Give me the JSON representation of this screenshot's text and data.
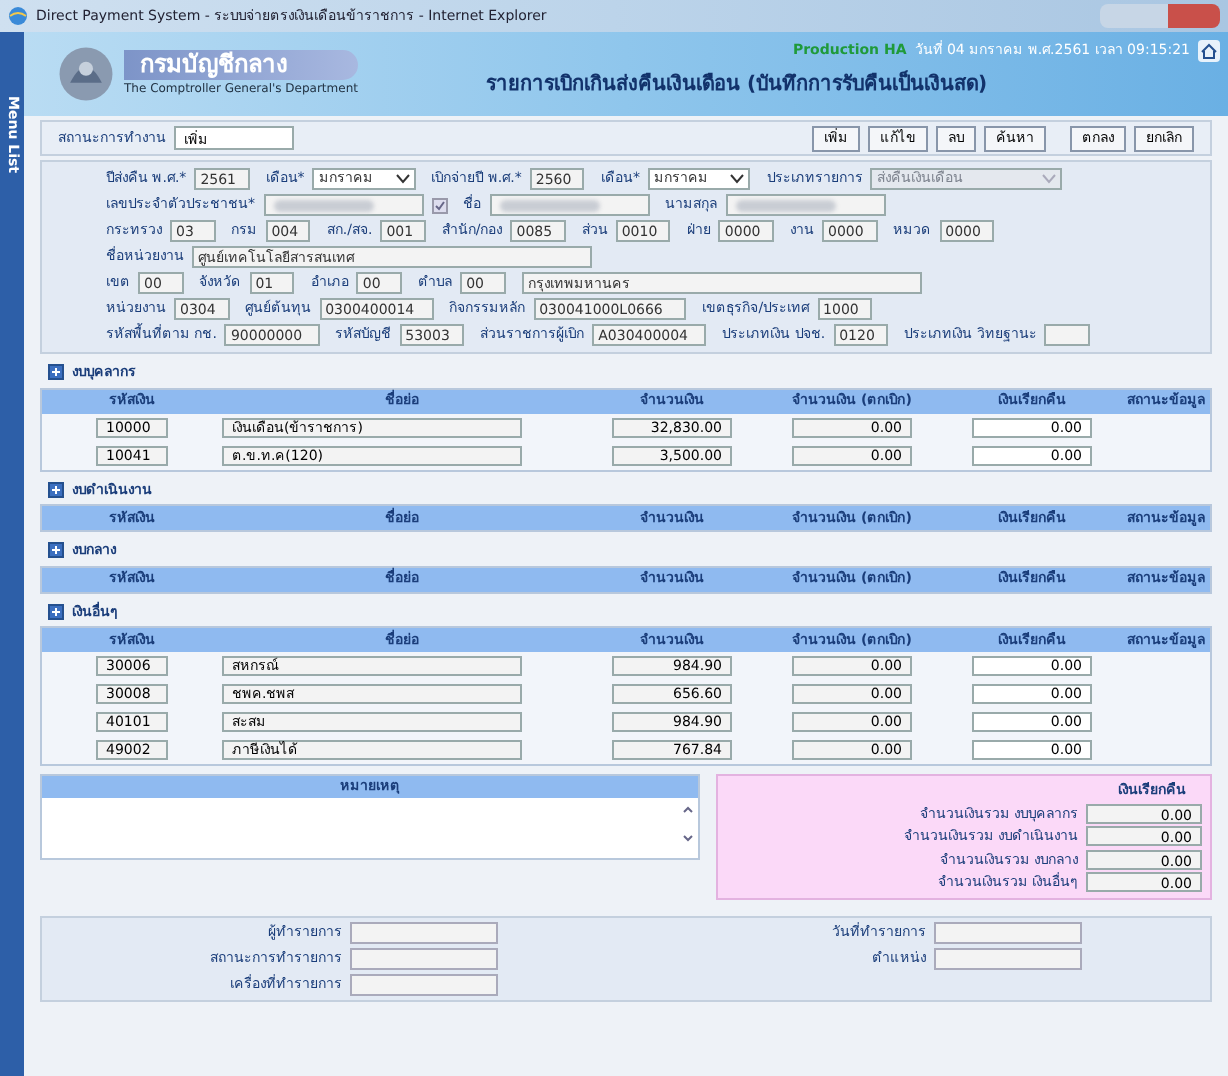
{
  "window": {
    "title": "Direct Payment System - ระบบจ่ายตรงเงินเดือนข้าราชการ - Internet Explorer"
  },
  "side_tab": {
    "label": "Menu List"
  },
  "header": {
    "org_name": "กรมบัญชีกลาง",
    "org_name_en": "The Comptroller General's Department",
    "environment": "Production HA",
    "datetime": "วันที่ 04 มกราคม พ.ศ.2561 เวลา 09:15:21",
    "page_title": "รายการเบิกเกินส่งคืนเงินเดือน (บันทึกการรับคืนเป็นเงินสด)"
  },
  "toolbar": {
    "status_label": "สถานะการทำงาน",
    "status_value": "เพิ่ม",
    "buttons": [
      "เพิ่ม",
      "แก้ไข",
      "ลบ",
      "ค้นหา",
      "ตกลง",
      "ยกเลิก"
    ]
  },
  "form": {
    "period": [
      {
        "label": "ปีส่งคืน พ.ศ.*",
        "value": "2561",
        "kind": "text"
      },
      {
        "label": "เดือน*",
        "value": "มกราคม",
        "kind": "select"
      },
      {
        "label": "เบิกจ่ายปี พ.ศ.*",
        "value": "2560",
        "kind": "text"
      },
      {
        "label": "เดือน*",
        "value": "มกราคม",
        "kind": "select"
      },
      {
        "label": "ประเภทรายการ",
        "value": "ส่งคืนเงินเดือน",
        "kind": "disabled_select"
      }
    ],
    "person": [
      {
        "label": "เลขประจำตัวประชาชน*",
        "kind": "redacted_check"
      },
      {
        "label": "ชื่อ",
        "kind": "redacted"
      },
      {
        "label": "นามสกุล",
        "kind": "redacted"
      }
    ],
    "org_codes": [
      {
        "label": "กระทรวง",
        "value": "03",
        "kind": "text"
      },
      {
        "label": "กรม",
        "value": "004",
        "kind": "text"
      },
      {
        "label": "สก./สจ.",
        "value": "001",
        "kind": "text"
      },
      {
        "label": "สำนัก/กอง",
        "value": "0085",
        "kind": "text"
      },
      {
        "label": "ส่วน",
        "value": "0010",
        "kind": "text"
      },
      {
        "label": "ฝ่าย",
        "value": "0000",
        "kind": "text"
      },
      {
        "label": "งาน",
        "value": "0000",
        "kind": "text"
      },
      {
        "label": "หมวด",
        "value": "0000",
        "kind": "text"
      }
    ],
    "unit": [
      {
        "label": "ชื่อหน่วยงาน",
        "value": "ศูนย์เทคโนโลยีสารสนเทศ",
        "kind": "wide"
      }
    ],
    "location": [
      {
        "label": "เขต",
        "value": "00",
        "kind": "text"
      },
      {
        "label": "จังหวัด",
        "value": "01",
        "kind": "text"
      },
      {
        "label": "อำเภอ",
        "value": "00",
        "kind": "text"
      },
      {
        "label": "ตำบล",
        "value": "00",
        "kind": "text"
      },
      {
        "value": "กรุงเทพมหานคร",
        "kind": "wide"
      }
    ],
    "accounts": [
      {
        "label": "หน่วยงาน",
        "value": "0304",
        "kind": "text"
      },
      {
        "label": "ศูนย์ต้นทุน",
        "value": "0300400014",
        "kind": "text"
      },
      {
        "label": "กิจกรรมหลัก",
        "value": "030041000L0666",
        "kind": "text"
      },
      {
        "label": "เขตธุรกิจ/ประเทศ",
        "value": "1000",
        "kind": "text"
      }
    ],
    "budget_codes": [
      {
        "label": "รหัสพื้นที่ตาม กช.",
        "value": "90000000",
        "kind": "text"
      },
      {
        "label": "รหัสบัญชี",
        "value": "53003",
        "kind": "text"
      },
      {
        "label": "ส่วนราชการผู้เบิก",
        "value": "A030400004",
        "kind": "text"
      },
      {
        "label": "ประเภทเงิน ปจช.",
        "value": "0120",
        "kind": "text"
      },
      {
        "label": "ประเภทเงิน วิทยฐานะ",
        "kind": "text"
      }
    ]
  },
  "sections": [
    {
      "title": "งบบุคลากร",
      "columns": [
        "รหัสเงิน",
        "ชื่อย่อ",
        "จำนวนเงิน",
        "จำนวนเงิน (ตกเบิก)",
        "เงินเรียกคืน",
        "สถานะข้อมูล"
      ],
      "rows": [
        {
          "code": "10000",
          "name": "เงินเดือน(ข้าราชการ)",
          "amount": "32,830.00",
          "arrears": "0.00",
          "refund": "0.00"
        },
        {
          "code": "10041",
          "name": "ต.ข.ท.ค(120)",
          "amount": "3,500.00",
          "arrears": "0.00",
          "refund": "0.00"
        }
      ]
    },
    {
      "title": "งบดำเนินงาน",
      "columns": [
        "รหัสเงิน",
        "ชื่อย่อ",
        "จำนวนเงิน",
        "จำนวนเงิน (ตกเบิก)",
        "เงินเรียกคืน",
        "สถานะข้อมูล"
      ]
    },
    {
      "title": "งบกลาง",
      "columns": [
        "รหัสเงิน",
        "ชื่อย่อ",
        "จำนวนเงิน",
        "จำนวนเงิน (ตกเบิก)",
        "เงินเรียกคืน",
        "สถานะข้อมูล"
      ]
    },
    {
      "title": "เงินอื่นๆ",
      "columns": [
        "รหัสเงิน",
        "ชื่อย่อ",
        "จำนวนเงิน",
        "จำนวนเงิน (ตกเบิก)",
        "เงินเรียกคืน",
        "สถานะข้อมูล"
      ],
      "rows": [
        {
          "code": "30006",
          "name": "สหกรณ์",
          "amount": "984.90",
          "arrears": "0.00",
          "refund": "0.00"
        },
        {
          "code": "30008",
          "name": "ชพค.ชพส",
          "amount": "656.60",
          "arrears": "0.00",
          "refund": "0.00"
        },
        {
          "code": "40101",
          "name": "สะสม",
          "amount": "984.90",
          "arrears": "0.00",
          "refund": "0.00"
        },
        {
          "code": "49002",
          "name": "ภาษีเงินได้",
          "amount": "767.84",
          "arrears": "0.00",
          "refund": "0.00"
        }
      ]
    }
  ],
  "notes": {
    "title": "หมายเหตุ"
  },
  "totals": {
    "header": "เงินเรียกคืน",
    "rows": [
      {
        "label": "จำนวนเงินรวม งบบุคลากร",
        "value": "0.00"
      },
      {
        "label": "จำนวนเงินรวม งบดำเนินงาน",
        "value": "0.00"
      },
      {
        "label": "จำนวนเงินรวม งบกลาง",
        "value": "0.00"
      },
      {
        "label": "จำนวนเงินรวม เงินอื่นๆ",
        "value": "0.00"
      }
    ]
  },
  "footer": {
    "left": [
      "ผู้ทำรายการ",
      "สถานะการทำรายการ",
      "เครื่องที่ทำรายการ"
    ],
    "right": [
      "วันที่ทำรายการ",
      "ตำแหน่ง"
    ]
  }
}
